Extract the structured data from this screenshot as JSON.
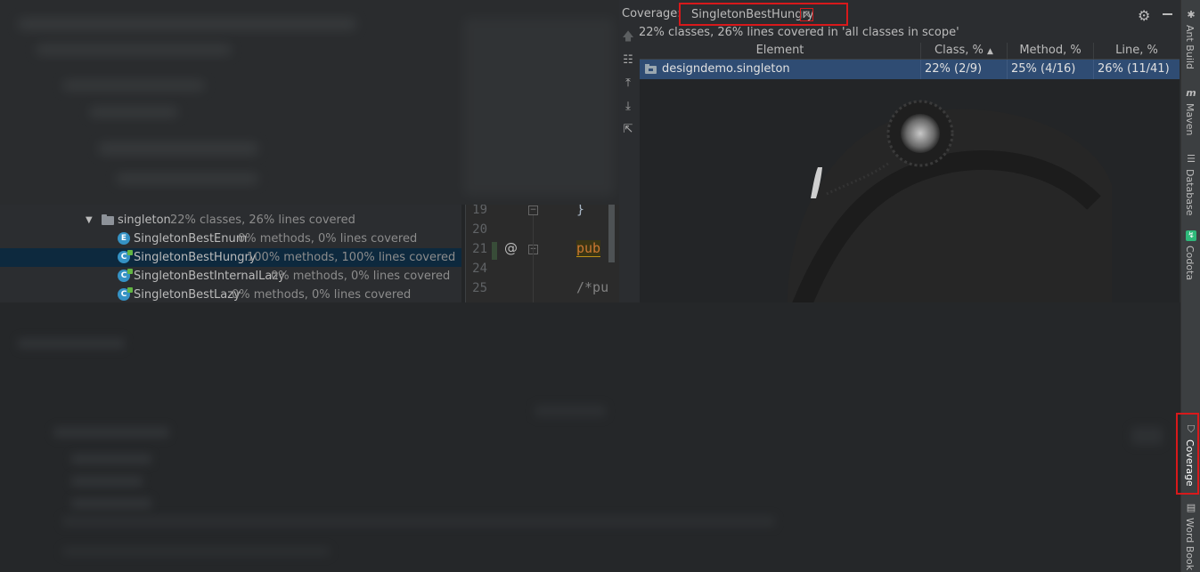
{
  "coverage_panel": {
    "label": "Coverage:",
    "tab_title": "SingletonBestHungry",
    "tab_close": "×",
    "summary": "22% classes, 26% lines covered in 'all classes in scope'",
    "columns": [
      "Element",
      "Class, %",
      "Method, %",
      "Line, %"
    ],
    "sort_indicator": "▲",
    "rows": [
      {
        "element": "designdemo.singleton",
        "class": "22% (2/9)",
        "method": "25% (4/16)",
        "line": "26% (11/41)"
      }
    ],
    "tools": [
      "up-arrow-icon",
      "flatten-packages-icon",
      "export-icon",
      "import-icon",
      "open-external-icon"
    ]
  },
  "project_tree": {
    "package": {
      "name": "singleton",
      "coverage": "22% classes, 26% lines covered"
    },
    "items": [
      {
        "name": "SingletonBestEnum",
        "coverage": "0% methods, 0% lines covered",
        "icon": "E",
        "selected": false
      },
      {
        "name": "SingletonBestHungry",
        "coverage": "100% methods, 100% lines covered",
        "icon": "C",
        "selected": true
      },
      {
        "name": "SingletonBestInternalLazy",
        "coverage": "0% methods, 0% lines covered",
        "icon": "C",
        "selected": false
      },
      {
        "name": "SingletonBestLazy",
        "coverage": "0% methods, 0% lines covered",
        "icon": "C",
        "selected": false
      }
    ]
  },
  "editor": {
    "line_numbers": [
      "19",
      "20",
      "21",
      "24",
      "25"
    ],
    "annotation": "@",
    "lines": [
      "}",
      "",
      "pub",
      "",
      "/*pu"
    ]
  },
  "right_stripe": {
    "items": [
      {
        "label": "Ant Build",
        "icon": "ant-icon"
      },
      {
        "label": "Maven",
        "icon": "maven-icon"
      },
      {
        "label": "Database",
        "icon": "database-icon"
      },
      {
        "label": "Codota",
        "icon": "codota-icon"
      },
      {
        "label": "Coverage",
        "icon": "shield-icon"
      },
      {
        "label": "Word Book",
        "icon": "book-icon"
      }
    ]
  },
  "colors": {
    "selection": "#2f4c73",
    "highlight_border": "#d8191b",
    "tree_selection": "#0d293e"
  }
}
